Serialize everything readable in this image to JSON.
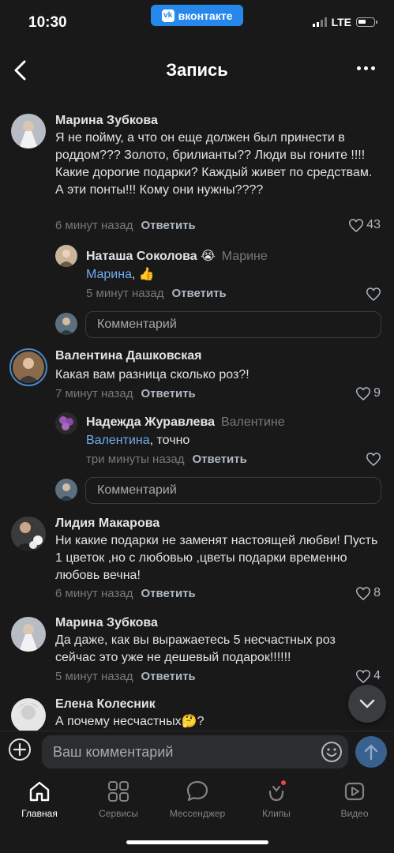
{
  "status": {
    "time": "10:30",
    "app_badge": "вконтакте",
    "network": "LTE"
  },
  "header": {
    "title": "Запись"
  },
  "comments": [
    {
      "author": "Марина Зубкова",
      "text": "Я не пойму, а что он еще должен был принести в роддом??? Золото, брилианты?? Люди вы гоните !!!! Какие дорогие подарки?  Каждый живет по средствам. А эти понты!!! Кому они нужны????",
      "time": "6 минут назад",
      "reply": "Ответить",
      "likes": "43"
    },
    {
      "author": "Наташа Соколова",
      "emoji": "😭",
      "reply_to": "Марине",
      "mention": "Марина",
      "text": ", 👍",
      "time": "5 минут назад",
      "reply": "Ответить",
      "likes": ""
    },
    {
      "author": "Валентина Дашковская",
      "text": "Какая вам разница сколько роз?!",
      "time": "7 минут назад",
      "reply": "Ответить",
      "likes": "9"
    },
    {
      "author": "Надежда Журавлева",
      "reply_to": "Валентине",
      "mention": "Валентина",
      "text": ", точно",
      "time": "три минуты назад",
      "reply": "Ответить",
      "likes": ""
    },
    {
      "author": "Лидия Макарова",
      "text": "Ни какие подарки не заменят настоящей любви! Пусть 1 цветок ,но с любовью ,цветы  подарки временно любовь вечна!",
      "time": "6 минут назад",
      "reply": "Ответить",
      "likes": "8"
    },
    {
      "author": "Марина Зубкова",
      "text": "Да даже, как вы выражаетесь 5 несчастных роз сейчас это уже не дешевый подарок!!!!!!",
      "time": "5 минут назад",
      "reply": "Ответить",
      "likes": "4"
    },
    {
      "author": "Елена Колесник",
      "text": "А почему несчастных🤔?",
      "time": "",
      "reply": "",
      "likes": ""
    }
  ],
  "reply_placeholder": "Комментарий",
  "input": {
    "placeholder": "Ваш комментарий"
  },
  "tabs": [
    {
      "label": "Главная",
      "icon": "home-icon",
      "active": true
    },
    {
      "label": "Сервисы",
      "icon": "grid-icon"
    },
    {
      "label": "Мессенджер",
      "icon": "chat-bubble-icon"
    },
    {
      "label": "Клипы",
      "icon": "clips-icon"
    },
    {
      "label": "Видео",
      "icon": "video-icon"
    }
  ],
  "colors": {
    "background": "#19191a",
    "link": "#71aaeb",
    "accent": "#2688eb"
  }
}
